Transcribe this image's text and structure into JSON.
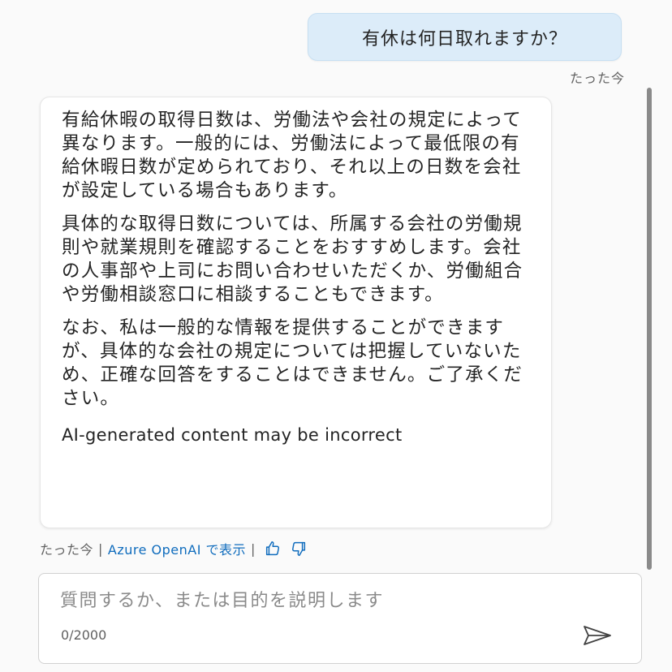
{
  "user_message": {
    "text": "有休は何日取れますか？",
    "time": "たった今"
  },
  "bot_message": {
    "paragraphs": [
      "有給休暇の取得日数は、労働法や会社の規定によって異なります。一般的には、労働法によって最低限の有給休暇日数が定められており、それ以上の日数を会社が設定している場合もあります。",
      "具体的な取得日数については、所属する会社の労働規則や就業規則を確認することをおすすめします。会社の人事部や上司にお問い合わせいただくか、労働組合や労働相談窓口に相談することもできます。",
      "なお、私は一般的な情報を提供することができますが、具体的な会社の規定については把握していないため、正確な回答をすることはできません。ご了承ください。"
    ],
    "disclaimer": "AI-generated content may be incorrect",
    "time": "たった今",
    "source_link": "Azure OpenAI で表示",
    "separator": "|"
  },
  "composer": {
    "placeholder": "質問するか、または目的を説明します",
    "value": "",
    "char_count": "0/2000"
  },
  "icons": {
    "thumbs_up": "thumbs-up-icon",
    "thumbs_down": "thumbs-down-icon",
    "send": "send-icon"
  },
  "colors": {
    "user_bubble": "#dcecf9",
    "link": "#0f6cbd",
    "scrollbar": "#8a8a8a"
  }
}
